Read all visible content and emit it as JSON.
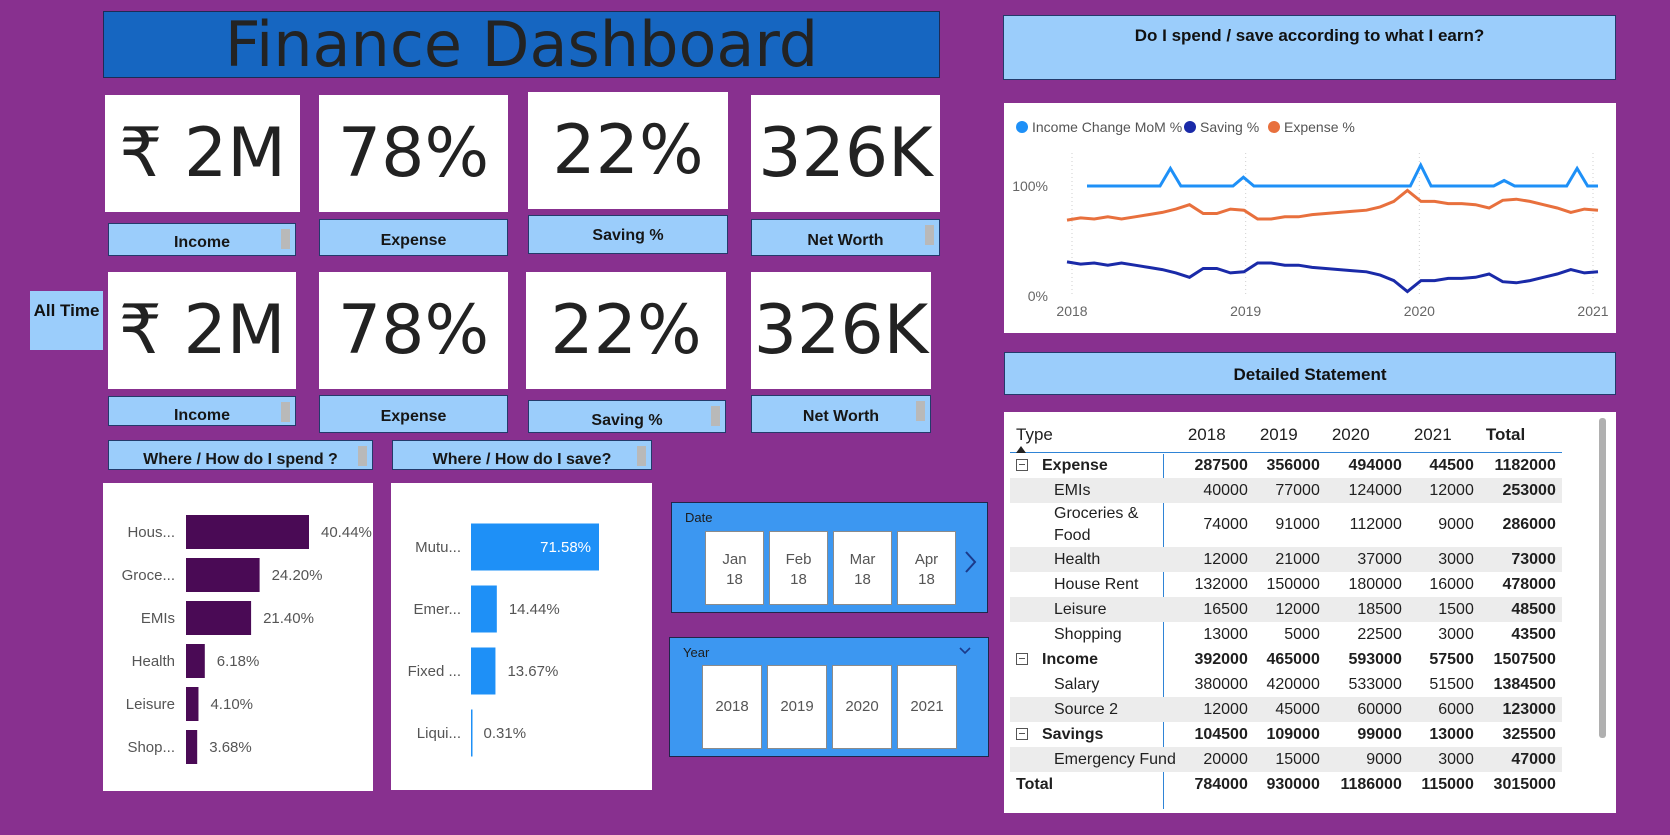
{
  "dashboard": {
    "title": "Finance Dashboard"
  },
  "kpis": {
    "row1": [
      {
        "value": "₹ 2M",
        "label": "Income"
      },
      {
        "value": "78%",
        "label": "Expense"
      },
      {
        "value": "22%",
        "label": "Saving %"
      },
      {
        "value": "326K",
        "label": "Net Worth"
      }
    ],
    "row2": [
      {
        "value": "₹ 2M",
        "label": "Income"
      },
      {
        "value": "78%",
        "label": "Expense"
      },
      {
        "value": "22%",
        "label": "Saving %"
      },
      {
        "value": "326K",
        "label": "Net Worth"
      }
    ],
    "all_time": "All Time"
  },
  "sections": {
    "spend_title": "Where / How do I spend ?",
    "save_title": "Where / How do I save?",
    "trend_title": "Do I spend / save according to what I earn?",
    "statement_title": "Detailed Statement"
  },
  "colors": {
    "purple_bar": "#4a0a55",
    "blue_bar": "#1e90f7",
    "income_line": "#1e90f7",
    "saving_line": "#1a2aa8",
    "expense_line": "#e8703d"
  },
  "chart_data": [
    {
      "type": "bar",
      "orientation": "horizontal",
      "categories": [
        "Hous...",
        "Groce...",
        "EMIs",
        "Health",
        "Leisure",
        "Shop..."
      ],
      "values": [
        40.44,
        24.2,
        21.4,
        6.18,
        4.1,
        3.68
      ],
      "value_labels": [
        "40.44%",
        "24.20%",
        "21.40%",
        "6.18%",
        "4.10%",
        "3.68%"
      ]
    },
    {
      "type": "bar",
      "orientation": "horizontal",
      "categories": [
        "Mutu...",
        "Emer...",
        "Fixed ...",
        "Liqui..."
      ],
      "values": [
        71.58,
        14.44,
        13.67,
        0.31
      ],
      "value_labels": [
        "71.58%",
        "14.44%",
        "13.67%",
        "0.31%"
      ]
    },
    {
      "type": "line",
      "xlim": [
        2018,
        2021
      ],
      "x_ticks": [
        "2018",
        "2019",
        "2020",
        "2021"
      ],
      "y_ticks": [
        "100%",
        "0%"
      ],
      "ylim": [
        0,
        130
      ],
      "legend": "top-left",
      "series": [
        {
          "name": "Income Change MoM %",
          "values": [
            100,
            100,
            100,
            100,
            100,
            100,
            100,
            100,
            116,
            100,
            100,
            100,
            100,
            100,
            100,
            108,
            100,
            100,
            100,
            100,
            100,
            100,
            100,
            100,
            100,
            100,
            100,
            100,
            100,
            100,
            100,
            100,
            119,
            100,
            100,
            100,
            100,
            100,
            100,
            100,
            105,
            100,
            100,
            100,
            100,
            100,
            100,
            116,
            100,
            100
          ]
        },
        {
          "name": "Saving %",
          "values": [
            31,
            29,
            30,
            28,
            30,
            28,
            26,
            24,
            21,
            17,
            25,
            25,
            21,
            22,
            30,
            30,
            28,
            28,
            26,
            25,
            24,
            23,
            22,
            19,
            14,
            4,
            14,
            14,
            16,
            16,
            17,
            20,
            13,
            12,
            14,
            17,
            20,
            24,
            21,
            22
          ]
        },
        {
          "name": "Expense %",
          "values": [
            69,
            71,
            70,
            72,
            70,
            72,
            74,
            76,
            79,
            83,
            75,
            75,
            79,
            78,
            70,
            70,
            72,
            72,
            74,
            75,
            76,
            77,
            78,
            81,
            86,
            96,
            86,
            86,
            84,
            84,
            83,
            80,
            87,
            88,
            86,
            83,
            80,
            76,
            79,
            78
          ]
        }
      ]
    }
  ],
  "date_slicer": {
    "header": "Date",
    "tiles": [
      {
        "m": "Jan",
        "y": "18"
      },
      {
        "m": "Feb",
        "y": "18"
      },
      {
        "m": "Mar",
        "y": "18"
      },
      {
        "m": "Apr",
        "y": "18"
      }
    ]
  },
  "year_slicer": {
    "header": "Year",
    "tiles": [
      "2018",
      "2019",
      "2020",
      "2021"
    ]
  },
  "statement": {
    "headers": [
      "Type",
      "2018",
      "2019",
      "2020",
      "2021",
      "Total"
    ],
    "rows": [
      {
        "kind": "group",
        "cells": [
          "Expense",
          "287500",
          "356000",
          "494000",
          "44500",
          "1182000"
        ]
      },
      {
        "kind": "sub",
        "cells": [
          "EMIs",
          "40000",
          "77000",
          "124000",
          "12000",
          "253000"
        ]
      },
      {
        "kind": "sub",
        "cells": [
          "Groceries & Food",
          "74000",
          "91000",
          "112000",
          "9000",
          "286000"
        ]
      },
      {
        "kind": "sub",
        "cells": [
          "Health",
          "12000",
          "21000",
          "37000",
          "3000",
          "73000"
        ]
      },
      {
        "kind": "sub",
        "cells": [
          "House Rent",
          "132000",
          "150000",
          "180000",
          "16000",
          "478000"
        ]
      },
      {
        "kind": "sub",
        "cells": [
          "Leisure",
          "16500",
          "12000",
          "18500",
          "1500",
          "48500"
        ]
      },
      {
        "kind": "sub",
        "cells": [
          "Shopping",
          "13000",
          "5000",
          "22500",
          "3000",
          "43500"
        ]
      },
      {
        "kind": "group",
        "cells": [
          "Income",
          "392000",
          "465000",
          "593000",
          "57500",
          "1507500"
        ]
      },
      {
        "kind": "sub",
        "cells": [
          "Salary",
          "380000",
          "420000",
          "533000",
          "51500",
          "1384500"
        ]
      },
      {
        "kind": "sub",
        "cells": [
          "Source 2",
          "12000",
          "45000",
          "60000",
          "6000",
          "123000"
        ]
      },
      {
        "kind": "group",
        "cells": [
          "Savings",
          "104500",
          "109000",
          "99000",
          "13000",
          "325500"
        ]
      },
      {
        "kind": "sub",
        "cells": [
          "Emergency Fund",
          "20000",
          "15000",
          "9000",
          "3000",
          "47000"
        ]
      }
    ],
    "total": [
      "Total",
      "784000",
      "930000",
      "1186000",
      "115000",
      "3015000"
    ]
  }
}
